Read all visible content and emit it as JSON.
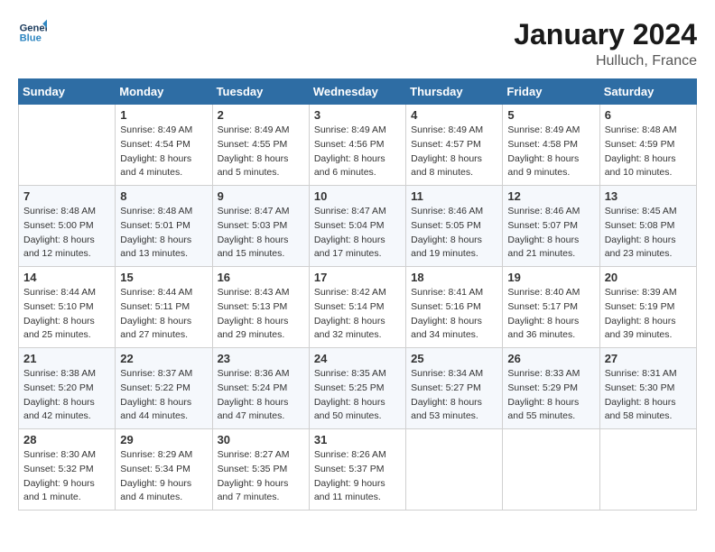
{
  "header": {
    "logo_line1": "General",
    "logo_line2": "Blue",
    "title": "January 2024",
    "location": "Hulluch, France"
  },
  "days_of_week": [
    "Sunday",
    "Monday",
    "Tuesday",
    "Wednesday",
    "Thursday",
    "Friday",
    "Saturday"
  ],
  "weeks": [
    [
      {
        "day": "",
        "info": ""
      },
      {
        "day": "1",
        "info": "Sunrise: 8:49 AM\nSunset: 4:54 PM\nDaylight: 8 hours\nand 4 minutes."
      },
      {
        "day": "2",
        "info": "Sunrise: 8:49 AM\nSunset: 4:55 PM\nDaylight: 8 hours\nand 5 minutes."
      },
      {
        "day": "3",
        "info": "Sunrise: 8:49 AM\nSunset: 4:56 PM\nDaylight: 8 hours\nand 6 minutes."
      },
      {
        "day": "4",
        "info": "Sunrise: 8:49 AM\nSunset: 4:57 PM\nDaylight: 8 hours\nand 8 minutes."
      },
      {
        "day": "5",
        "info": "Sunrise: 8:49 AM\nSunset: 4:58 PM\nDaylight: 8 hours\nand 9 minutes."
      },
      {
        "day": "6",
        "info": "Sunrise: 8:48 AM\nSunset: 4:59 PM\nDaylight: 8 hours\nand 10 minutes."
      }
    ],
    [
      {
        "day": "7",
        "info": "Sunrise: 8:48 AM\nSunset: 5:00 PM\nDaylight: 8 hours\nand 12 minutes."
      },
      {
        "day": "8",
        "info": "Sunrise: 8:48 AM\nSunset: 5:01 PM\nDaylight: 8 hours\nand 13 minutes."
      },
      {
        "day": "9",
        "info": "Sunrise: 8:47 AM\nSunset: 5:03 PM\nDaylight: 8 hours\nand 15 minutes."
      },
      {
        "day": "10",
        "info": "Sunrise: 8:47 AM\nSunset: 5:04 PM\nDaylight: 8 hours\nand 17 minutes."
      },
      {
        "day": "11",
        "info": "Sunrise: 8:46 AM\nSunset: 5:05 PM\nDaylight: 8 hours\nand 19 minutes."
      },
      {
        "day": "12",
        "info": "Sunrise: 8:46 AM\nSunset: 5:07 PM\nDaylight: 8 hours\nand 21 minutes."
      },
      {
        "day": "13",
        "info": "Sunrise: 8:45 AM\nSunset: 5:08 PM\nDaylight: 8 hours\nand 23 minutes."
      }
    ],
    [
      {
        "day": "14",
        "info": "Sunrise: 8:44 AM\nSunset: 5:10 PM\nDaylight: 8 hours\nand 25 minutes."
      },
      {
        "day": "15",
        "info": "Sunrise: 8:44 AM\nSunset: 5:11 PM\nDaylight: 8 hours\nand 27 minutes."
      },
      {
        "day": "16",
        "info": "Sunrise: 8:43 AM\nSunset: 5:13 PM\nDaylight: 8 hours\nand 29 minutes."
      },
      {
        "day": "17",
        "info": "Sunrise: 8:42 AM\nSunset: 5:14 PM\nDaylight: 8 hours\nand 32 minutes."
      },
      {
        "day": "18",
        "info": "Sunrise: 8:41 AM\nSunset: 5:16 PM\nDaylight: 8 hours\nand 34 minutes."
      },
      {
        "day": "19",
        "info": "Sunrise: 8:40 AM\nSunset: 5:17 PM\nDaylight: 8 hours\nand 36 minutes."
      },
      {
        "day": "20",
        "info": "Sunrise: 8:39 AM\nSunset: 5:19 PM\nDaylight: 8 hours\nand 39 minutes."
      }
    ],
    [
      {
        "day": "21",
        "info": "Sunrise: 8:38 AM\nSunset: 5:20 PM\nDaylight: 8 hours\nand 42 minutes."
      },
      {
        "day": "22",
        "info": "Sunrise: 8:37 AM\nSunset: 5:22 PM\nDaylight: 8 hours\nand 44 minutes."
      },
      {
        "day": "23",
        "info": "Sunrise: 8:36 AM\nSunset: 5:24 PM\nDaylight: 8 hours\nand 47 minutes."
      },
      {
        "day": "24",
        "info": "Sunrise: 8:35 AM\nSunset: 5:25 PM\nDaylight: 8 hours\nand 50 minutes."
      },
      {
        "day": "25",
        "info": "Sunrise: 8:34 AM\nSunset: 5:27 PM\nDaylight: 8 hours\nand 53 minutes."
      },
      {
        "day": "26",
        "info": "Sunrise: 8:33 AM\nSunset: 5:29 PM\nDaylight: 8 hours\nand 55 minutes."
      },
      {
        "day": "27",
        "info": "Sunrise: 8:31 AM\nSunset: 5:30 PM\nDaylight: 8 hours\nand 58 minutes."
      }
    ],
    [
      {
        "day": "28",
        "info": "Sunrise: 8:30 AM\nSunset: 5:32 PM\nDaylight: 9 hours\nand 1 minute."
      },
      {
        "day": "29",
        "info": "Sunrise: 8:29 AM\nSunset: 5:34 PM\nDaylight: 9 hours\nand 4 minutes."
      },
      {
        "day": "30",
        "info": "Sunrise: 8:27 AM\nSunset: 5:35 PM\nDaylight: 9 hours\nand 7 minutes."
      },
      {
        "day": "31",
        "info": "Sunrise: 8:26 AM\nSunset: 5:37 PM\nDaylight: 9 hours\nand 11 minutes."
      },
      {
        "day": "",
        "info": ""
      },
      {
        "day": "",
        "info": ""
      },
      {
        "day": "",
        "info": ""
      }
    ]
  ]
}
